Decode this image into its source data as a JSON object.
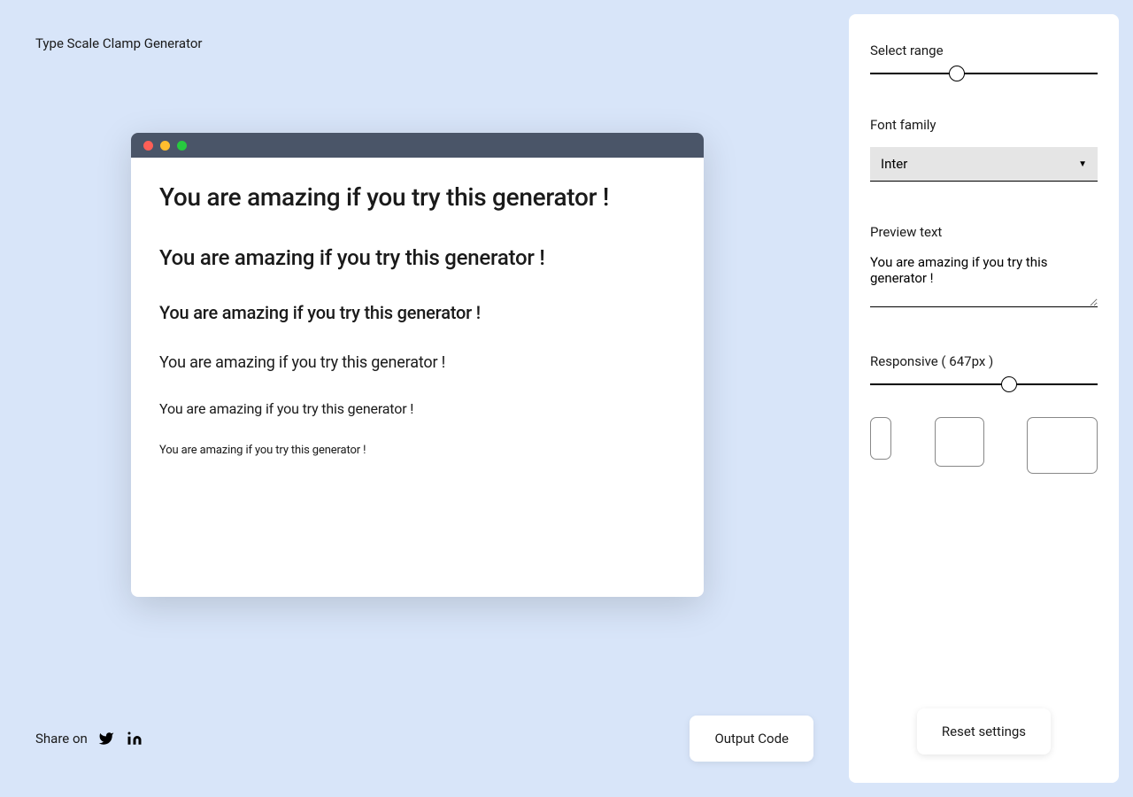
{
  "title": "Type Scale Clamp Generator",
  "preview_text": "You are amazing if you try this generator !",
  "share": {
    "label": "Share on"
  },
  "buttons": {
    "output": "Output Code",
    "reset": "Reset settings"
  },
  "sidebar": {
    "range_label": "Select range",
    "range_percent": 38,
    "font_label": "Font family",
    "font_selected": "Inter",
    "preview_label": "Preview text",
    "preview_value": "You are amazing if you try this generator !",
    "responsive_label": "Responsive ( 647px )",
    "responsive_percent": 61
  }
}
